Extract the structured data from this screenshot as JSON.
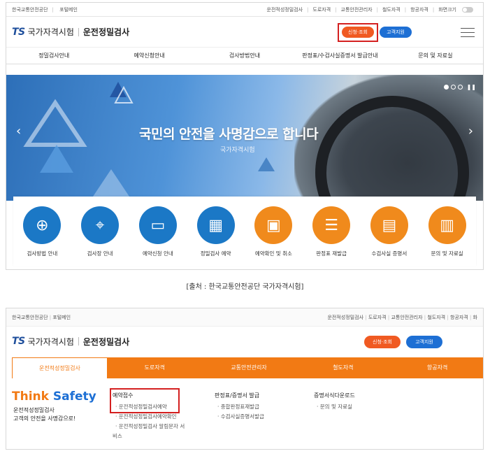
{
  "shot1": {
    "util_left": [
      "한국교통안전공단",
      "포털메인"
    ],
    "util_right": [
      "운전적성정밀검사",
      "도로자격",
      "교통안전관리자",
      "철도자격",
      "항공자격",
      "화면크기"
    ],
    "logo_ts": "TS",
    "logo_name": "국가자격시험",
    "logo_sub": "운전정밀검사",
    "btn_apply": "신청·조회",
    "btn_support": "고객지원",
    "gnb": [
      "정밀검사안내",
      "예약신청안내",
      "검사방법안내",
      "판정표/수검사실증명서 발급안내",
      "문의 및 자료실"
    ],
    "hero_title": "국민의 안전을 사명감으로 합니다",
    "hero_sub": "국가자격시험",
    "quick": [
      {
        "icon": "target-icon",
        "glyph": "⊕",
        "label": "검사방법 안내",
        "color": "blue"
      },
      {
        "icon": "map-pin-icon",
        "glyph": "⌖",
        "label": "검사장 안내",
        "color": "blue"
      },
      {
        "icon": "presentation-icon",
        "glyph": "▭",
        "label": "예약신청 안내",
        "color": "blue"
      },
      {
        "icon": "calendar-icon",
        "glyph": "▦",
        "label": "정밀검사 예약",
        "color": "blue"
      },
      {
        "icon": "laptop-icon",
        "glyph": "▣",
        "label": "예약확인 및 취소",
        "color": "orange"
      },
      {
        "icon": "checklist-icon",
        "glyph": "☰",
        "label": "판정표 재발급",
        "color": "orange"
      },
      {
        "icon": "certificate-icon",
        "glyph": "▤",
        "label": "수검사실 증명서",
        "color": "orange"
      },
      {
        "icon": "clipboard-icon",
        "glyph": "▥",
        "label": "문의 및 자료실",
        "color": "orange"
      }
    ]
  },
  "caption": "[출처 : 한국교통안전공단 국가자격시험]",
  "shot2": {
    "util_left": [
      "한국교통안전공단",
      "포털메인"
    ],
    "util_right": [
      "운전적성정밀검사",
      "도로자격",
      "교통안전관리자",
      "철도자격",
      "항공자격",
      "화"
    ],
    "logo_ts": "TS",
    "logo_name": "국가자격시험",
    "logo_sub": "운전정밀검사",
    "btn_apply": "신청·조회",
    "btn_support": "고객지원",
    "tabs": [
      "운전적성정밀검사",
      "도로자격",
      "교통안전관리자",
      "철도자격",
      "항공자격"
    ],
    "think_1": "Think",
    "think_2": "Safety",
    "desc_1": "운전적성정밀검사",
    "desc_2": "고객의 안전을 사명감으로!",
    "col1_head": "예약접수",
    "col1_items": [
      "· 운전적성정밀검사예약",
      "· 운전적성정밀검사예약확인",
      "· 운전적성정밀검사 알림문자 서",
      "비스"
    ],
    "col2_head": "판정표/증명서 발급",
    "col2_items": [
      "· 종합판정표재발급",
      "· 수검사실증명서발급"
    ],
    "col3_head": "증명서식다운로드",
    "col3_items": [
      "· 문의 및 자료실"
    ]
  },
  "colors": {
    "orange": "#f05a22",
    "blue": "#1d6fd4",
    "tab_orange": "#f27a14",
    "highlight": "#d42020"
  }
}
